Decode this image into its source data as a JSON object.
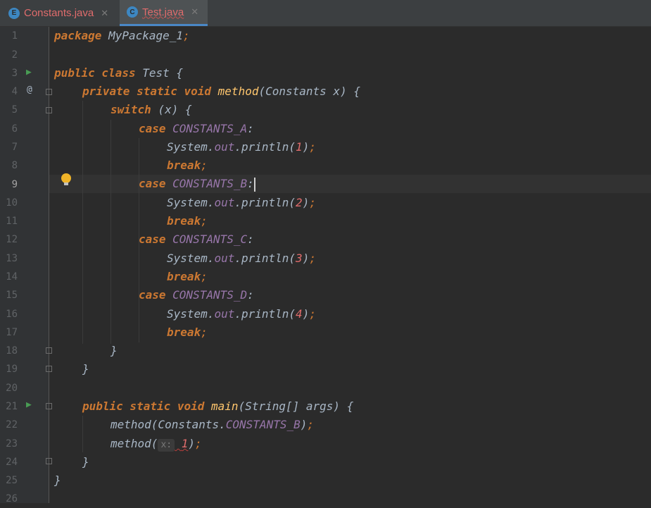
{
  "tabs": [
    {
      "name": "Constants.java",
      "icon_letter": "E",
      "icon_color": "#3d87c2",
      "active": false
    },
    {
      "name": "Test.java",
      "icon_letter": "C",
      "icon_color": "#3d87c2",
      "active": true
    }
  ],
  "editor": {
    "line_numbers": [
      "1",
      "2",
      "3",
      "4",
      "5",
      "6",
      "7",
      "8",
      "9",
      "10",
      "11",
      "12",
      "13",
      "14",
      "15",
      "16",
      "17",
      "18",
      "19",
      "20",
      "21",
      "22",
      "23",
      "24",
      "25",
      "26"
    ],
    "current_line": "9",
    "lines": {
      "l1": {
        "kw": "package",
        "rest": " MyPackage_1",
        "semi": ";"
      },
      "l3": {
        "kw": "public class",
        "rest": " Test {"
      },
      "l4": {
        "kw": "private static void",
        "fn": " method",
        "rest": "(Constants x) {"
      },
      "l5": {
        "kw": "switch",
        "rest": " (x) {"
      },
      "l6": {
        "kw": "case",
        "cst": " CONSTANTS_A",
        "rest": ":"
      },
      "l7": {
        "plain": "System.",
        "cst": "out",
        "rest": ".println(",
        "num": "1",
        "close": ")",
        "semi": ";"
      },
      "l8": {
        "kw": "break",
        "semi": ";"
      },
      "l9": {
        "kw": "case",
        "cst": " CONSTANTS_B",
        "rest": ":"
      },
      "l10": {
        "plain": "System.",
        "cst": "out",
        "rest": ".println(",
        "num": "2",
        "close": ")",
        "semi": ";"
      },
      "l11": {
        "kw": "break",
        "semi": ";"
      },
      "l12": {
        "kw": "case",
        "cst": " CONSTANTS_C",
        "rest": ":"
      },
      "l13": {
        "plain": "System.",
        "cst": "out",
        "rest": ".println(",
        "num": "3",
        "close": ")",
        "semi": ";"
      },
      "l14": {
        "kw": "break",
        "semi": ";"
      },
      "l15": {
        "kw": "case",
        "cst": " CONSTANTS_D",
        "rest": ":"
      },
      "l16": {
        "plain": "System.",
        "cst": "out",
        "rest": ".println(",
        "num": "4",
        "close": ")",
        "semi": ";"
      },
      "l17": {
        "kw": "break",
        "semi": ";"
      },
      "l18": {
        "rest": "}"
      },
      "l19": {
        "rest": "}"
      },
      "l21": {
        "kw": "public static void",
        "fn": " main",
        "rest": "(String[] args) {"
      },
      "l22": {
        "plain": "method(Constants.",
        "cst": "CONSTANTS_B",
        "close": ")",
        "semi": ";"
      },
      "l23": {
        "plain": "method(",
        "hint": "x:",
        "num": "1",
        "close": ")",
        "semi": ";"
      },
      "l24": {
        "rest": "}"
      },
      "l25": {
        "rest": "}"
      }
    }
  },
  "gutter_icons": {
    "run": "run-arrow-icon",
    "override": "at-override-icon",
    "bulb": "lightbulb-icon",
    "fold": "fold-marker-icon"
  },
  "colors": {
    "keyword": "#cc7832",
    "function": "#ffc66d",
    "constant": "#9876aa",
    "number": "#6897bb",
    "text": "#a9b7c6",
    "background": "#2b2b2b"
  }
}
